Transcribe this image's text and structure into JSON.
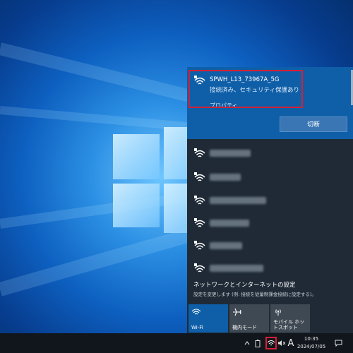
{
  "flyout": {
    "connected_network": {
      "ssid": "SPWH_L13_73967A_5G",
      "status": "接続済み、セキュリティ保護あり",
      "properties_link": "プロパティ",
      "disconnect_label": "切断"
    },
    "other_networks": [
      {
        "name": ""
      },
      {
        "name": ""
      },
      {
        "name": ""
      },
      {
        "name": ""
      },
      {
        "name": ""
      },
      {
        "name": ""
      }
    ],
    "settings_title": "ネットワークとインターネットの設定",
    "settings_subtitle": "設定を変更します (例: 接続を従量制課金接続に設定する)。",
    "quick_actions": [
      {
        "label": "Wi-Fi",
        "icon": "wifi-icon",
        "active": true
      },
      {
        "label": "機内モード",
        "icon": "airplane-icon",
        "active": false
      },
      {
        "label": "モバイル ホットスポット",
        "icon": "hotspot-icon",
        "active": false
      }
    ]
  },
  "taskbar": {
    "time": "10:35",
    "date": "2024/07/05",
    "ime_indicator": "A"
  },
  "colors": {
    "accent": "#0f5fa8",
    "highlight_border": "#d32036",
    "flyout_bg": "#1f2a36",
    "taskbar_bg": "#11161c"
  }
}
